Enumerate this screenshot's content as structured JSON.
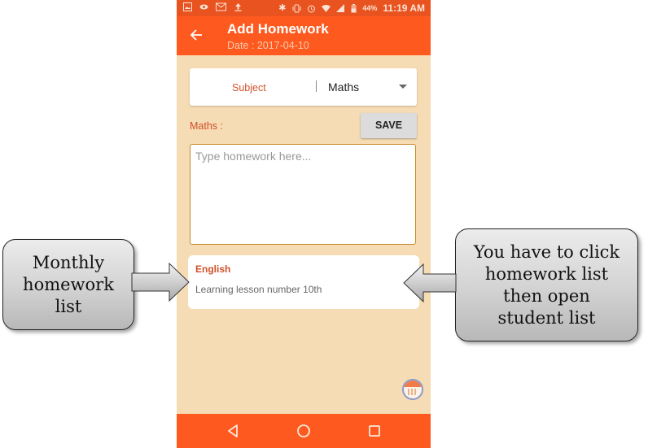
{
  "status_bar": {
    "left_icons": [
      "image-icon",
      "eye-icon",
      "gmail-icon",
      "upload-icon"
    ],
    "right_icons": [
      "bluetooth-icon",
      "vibrate-icon",
      "alarm-icon",
      "wifi-icon",
      "signal-icon",
      "battery-icon"
    ],
    "battery_percent": "44%",
    "time": "11:19 AM"
  },
  "app_bar": {
    "back_icon": "arrow-left-icon",
    "title": "Add Homework",
    "subtitle": "Date : 2017-04-10"
  },
  "form": {
    "subject_label": "Subject",
    "subject_value": "Maths",
    "selected_subject_label": "Maths :",
    "save_label": "SAVE",
    "homework_placeholder": "Type homework here...",
    "homework_value": ""
  },
  "homework_list": [
    {
      "subject": "English",
      "description": "Learning lesson number 10th"
    }
  ],
  "fab": {
    "icon": "calendar-icon"
  },
  "nav_bar": {
    "buttons": [
      "back-triangle-icon",
      "home-circle-icon",
      "recent-square-icon"
    ]
  },
  "annotations": {
    "left": {
      "lines": [
        "Monthly",
        "homework",
        "list"
      ]
    },
    "right": {
      "lines": [
        "You have to click",
        "homework list",
        "then open",
        "student list"
      ]
    }
  },
  "colors": {
    "status_bar": "#e8531f",
    "app_bar": "#fe5a1f",
    "background": "#f5dcb4",
    "accent_text": "#d1502a",
    "textarea_border": "#c68a2a"
  }
}
